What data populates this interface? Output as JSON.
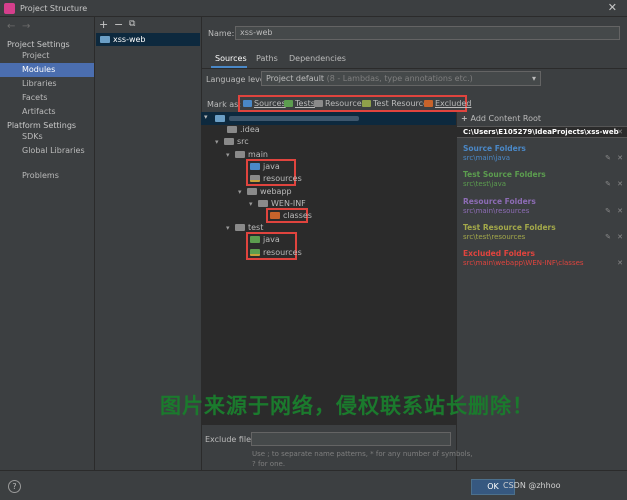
{
  "window": {
    "title": "Project Structure",
    "close": "✕"
  },
  "nav": {
    "back": "←",
    "forward": "→",
    "section1": "Project Settings",
    "items1": [
      "Project",
      "Modules",
      "Libraries",
      "Facets",
      "Artifacts"
    ],
    "section2": "Platform Settings",
    "items2": [
      "SDKs",
      "Global Libraries"
    ],
    "problems": "Problems"
  },
  "modules": {
    "add": "+",
    "remove": "−",
    "copy": "⧉",
    "item": "xss-web"
  },
  "name": {
    "label": "Name:",
    "value": "xss-web"
  },
  "tabs": [
    "Sources",
    "Paths",
    "Dependencies"
  ],
  "language": {
    "label": "Language level:",
    "value": "Project default",
    "hint": "(8 - Lambdas, type annotations etc.)"
  },
  "markas": {
    "label": "Mark as:",
    "items": [
      {
        "label": "Sources",
        "color": "#4a88c7"
      },
      {
        "label": "Tests",
        "color": "#5c9d4f"
      },
      {
        "label": "Resources",
        "color": "#8a8a8a"
      },
      {
        "label": "Test Resources",
        "color": "#8fa04a"
      },
      {
        "label": "Excluded",
        "color": "#c7632b"
      }
    ]
  },
  "tree": {
    "idea": ".idea",
    "src": "src",
    "main": "main",
    "java": "java",
    "resources": "resources",
    "webapp": "webapp",
    "webinf": "WEN-INF",
    "classes": "classes",
    "test": "test",
    "tjava": "java",
    "tresources": "resources"
  },
  "root_panel": {
    "add": "Add Content Root",
    "path": "C:\\Users\\E105279\\IdeaProjects\\xss-web",
    "source_h": "Source Folders",
    "source_v": "src\\main\\java",
    "test_h": "Test Source Folders",
    "test_v": "src\\test\\java",
    "res_h": "Resource Folders",
    "res_v": "src\\main\\resources",
    "tres_h": "Test Resource Folders",
    "tres_v": "src\\test\\resources",
    "exc_h": "Excluded Folders",
    "exc_v": "src\\main\\webapp\\WEN-INF\\classes",
    "colors": {
      "source": "#4a88c7",
      "test": "#5c9d4f",
      "res": "#8d6cb5",
      "tres": "#a3a84a",
      "exc": "#e0443e"
    }
  },
  "exclude": {
    "label": "Exclude files:",
    "hint1": "Use ; to separate name patterns, * for any number of symbols,",
    "hint2": "? for one."
  },
  "footer": {
    "ok": "OK",
    "help": "?",
    "csdn": "CSDN @zhhoo",
    "watermark": "图片来源于网络，侵权联系站长删除！"
  }
}
